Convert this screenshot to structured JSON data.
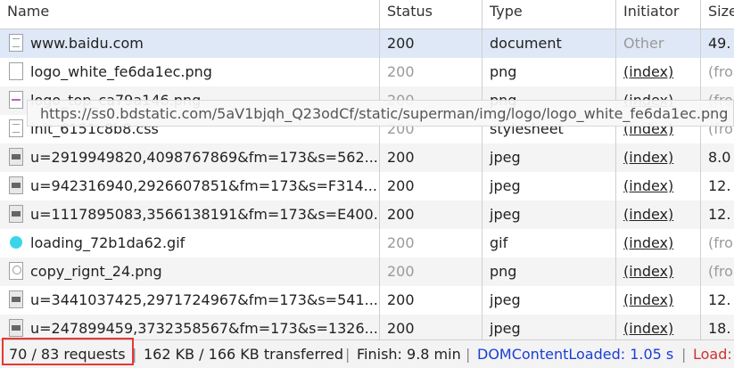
{
  "columns": {
    "name": "Name",
    "status": "Status",
    "type": "Type",
    "initiator": "Initiator",
    "size": "Size"
  },
  "rows": [
    {
      "name": "www.baidu.com",
      "status": "200",
      "type": "document",
      "initiator": "Other",
      "size": "49.",
      "icon": "document-icon"
    },
    {
      "name": "logo_white_fe6da1ec.png",
      "status": "200",
      "type": "png",
      "initiator": "(index)",
      "size": "(fro",
      "icon": "png-file-icon"
    },
    {
      "name": "logo_top_ca79a146.png",
      "status": "200",
      "type": "png",
      "initiator": "(index)",
      "size": "(fro",
      "icon": "image-thumb-icon"
    },
    {
      "name": "init_6151c8b8.css",
      "status": "200",
      "type": "stylesheet",
      "initiator": "(index)",
      "size": "(fro",
      "icon": "css-file-icon"
    },
    {
      "name": "u=2919949820,4098767869&fm=173&s=562...",
      "status": "200",
      "type": "jpeg",
      "initiator": "(index)",
      "size": "8.0",
      "icon": "jpeg-thumb-icon"
    },
    {
      "name": "u=942316940,2926607851&fm=173&s=F314...",
      "status": "200",
      "type": "jpeg",
      "initiator": "(index)",
      "size": "12.",
      "icon": "jpeg-thumb-icon"
    },
    {
      "name": "u=1117895083,3566138191&fm=173&s=E400...",
      "status": "200",
      "type": "jpeg",
      "initiator": "(index)",
      "size": "12.",
      "icon": "jpeg-thumb-icon"
    },
    {
      "name": "loading_72b1da62.gif",
      "status": "200",
      "type": "gif",
      "initiator": "(index)",
      "size": "(fro",
      "icon": "gif-thumb-icon"
    },
    {
      "name": "copy_rignt_24.png",
      "status": "200",
      "type": "png",
      "initiator": "(index)",
      "size": "(fro",
      "icon": "png-thumb-icon"
    },
    {
      "name": "u=3441037425,2971724967&fm=173&s=541...",
      "status": "200",
      "type": "jpeg",
      "initiator": "(index)",
      "size": "12.",
      "icon": "jpeg-thumb-icon"
    },
    {
      "name": "u=247899459,3732358567&fm=173&s=1326...",
      "status": "200",
      "type": "jpeg",
      "initiator": "(index)",
      "size": "18.",
      "icon": "jpeg-thumb-icon"
    }
  ],
  "tooltip": "https://ss0.bdstatic.com/5aV1bjqh_Q23odCf/static/superman/img/logo/logo_white_fe6da1ec.png",
  "footer": {
    "requests": "70 / 83 requests",
    "transferred": "162 KB / 166 KB transferred",
    "finish": "Finish: 9.8 min",
    "dcl": "DOMContentLoaded: 1.05 s",
    "load": "Load:",
    "separator": "|"
  },
  "colors": {
    "selected_row": "#dfe8f6",
    "dcl": "#1a3fd6",
    "load": "#d32f2f",
    "highlight_box": "#e53935"
  }
}
